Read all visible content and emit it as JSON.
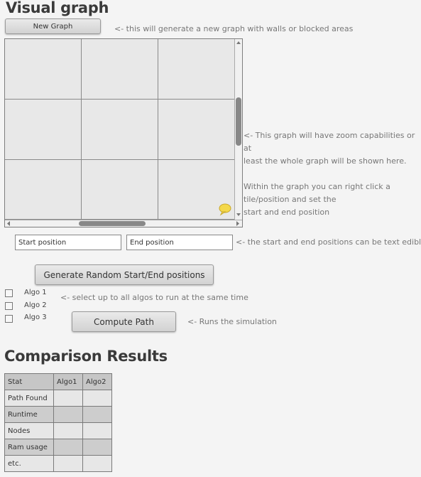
{
  "header": {
    "title": "Visual graph"
  },
  "new_graph": {
    "label": "New Graph",
    "note": "<- this will generate a new graph with walls or blocked areas"
  },
  "graph": {
    "rows": 3,
    "cols": 3,
    "notes": [
      "<- This graph will have zoom capabilities or at",
      "least the whole graph will be shown here.",
      "",
      "Within the graph you can right click a",
      "tile/position and set the",
      "start and end position"
    ],
    "marker_color": "#f4d84a"
  },
  "positions": {
    "start_value": "Start position",
    "end_value": "End position",
    "note": "<- the start and end positions can be text edible"
  },
  "random_button": {
    "label": "Generate Random Start/End positions"
  },
  "algos": {
    "items": [
      {
        "label": "Algo 1",
        "checked": false
      },
      {
        "label": "Algo 2",
        "checked": false
      },
      {
        "label": "Algo 3",
        "checked": false
      }
    ],
    "note": "<- select up to all algos to run at the same time"
  },
  "compute": {
    "label": "Compute Path",
    "note": "<- Runs the simulation"
  },
  "results": {
    "title": "Comparison Results",
    "headers": [
      "Stat",
      "Algo1",
      "Algo2"
    ],
    "rows": [
      [
        "Path Found",
        "",
        ""
      ],
      [
        "Runtime",
        "",
        ""
      ],
      [
        "Nodes",
        "",
        ""
      ],
      [
        "Ram usage",
        "",
        ""
      ],
      [
        "etc.",
        "",
        ""
      ]
    ]
  }
}
